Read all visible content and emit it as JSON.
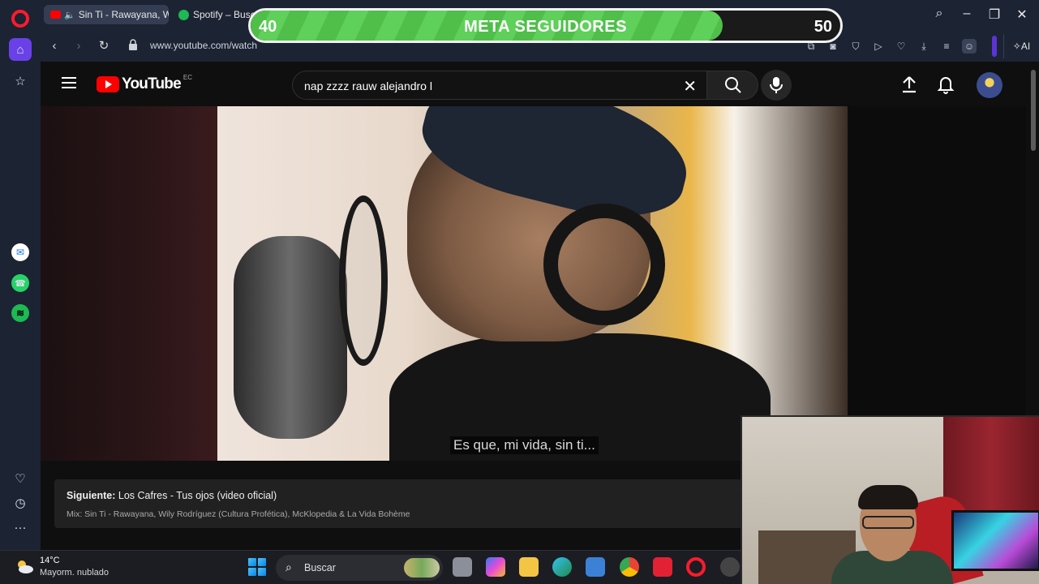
{
  "browser": {
    "tabs": [
      {
        "label": "Sin Ti - Rawayana, Wil"
      },
      {
        "label": "Spotify – Buscar"
      }
    ],
    "url": "www.youtube.com/watch",
    "ai_label": "AI"
  },
  "overlay": {
    "goal_start": "40",
    "goal_title": "META SEGUIDORES",
    "goal_end": "50",
    "progress": 0.8
  },
  "youtube": {
    "logo_text": "YouTube",
    "country": "EC",
    "search_query": "nap zzzz rauw alejandro l",
    "subtitle": "Es que, mi vida, sin ti...",
    "next_label": "Siguiente:",
    "next_title": "Los Cafres - Tus ojos (video oficial)",
    "next_sub": "Mix: Sin Ti - Rawayana, Wily Rodríguez (Cultura Profética), McKlopedia & La Vida Bohème"
  },
  "taskbar": {
    "temp": "14°C",
    "weather": "Mayorm. nublado",
    "search_label": "Buscar"
  },
  "colors": {
    "opera_red": "#ff1b2d",
    "yt_red": "#ff0000",
    "goal_green": "#4fbf4a"
  }
}
